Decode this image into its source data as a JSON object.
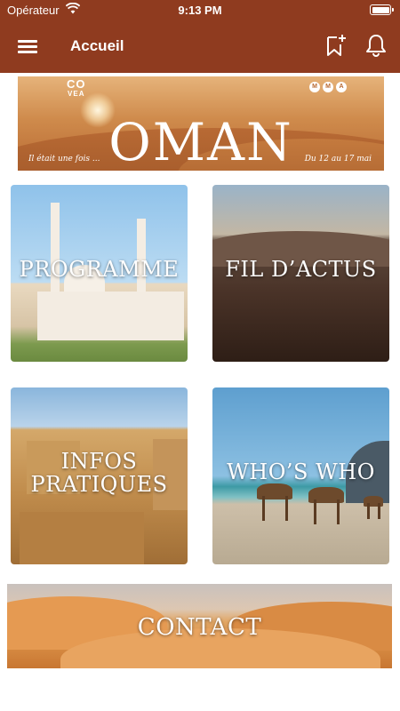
{
  "status_bar": {
    "carrier": "Opérateur",
    "time": "9:13 PM"
  },
  "nav": {
    "title": "Accueil"
  },
  "banner": {
    "headline": "OMAN",
    "tagline_left": "Il était une fois ...",
    "tagline_right": "Du 12 au 17 mai",
    "brand_left_top": "CO",
    "brand_left_bottom": "VEA",
    "brand_right_letters": [
      "M",
      "M",
      "A"
    ]
  },
  "tiles": [
    {
      "label": "PROGRAMME"
    },
    {
      "label": "FIL D’ACTUS"
    },
    {
      "label_line1": "INFOS",
      "label_line2": "PRATIQUES"
    },
    {
      "label": "WHO’S WHO"
    },
    {
      "label": "CONTACT"
    }
  ],
  "colors": {
    "nav_background": "#8f3b1f",
    "nav_foreground": "#ffffff",
    "page_background": "#ffffff"
  },
  "icons": [
    "menu-icon",
    "bookmark-add-icon",
    "bell-icon",
    "wifi-icon",
    "battery-icon"
  ]
}
